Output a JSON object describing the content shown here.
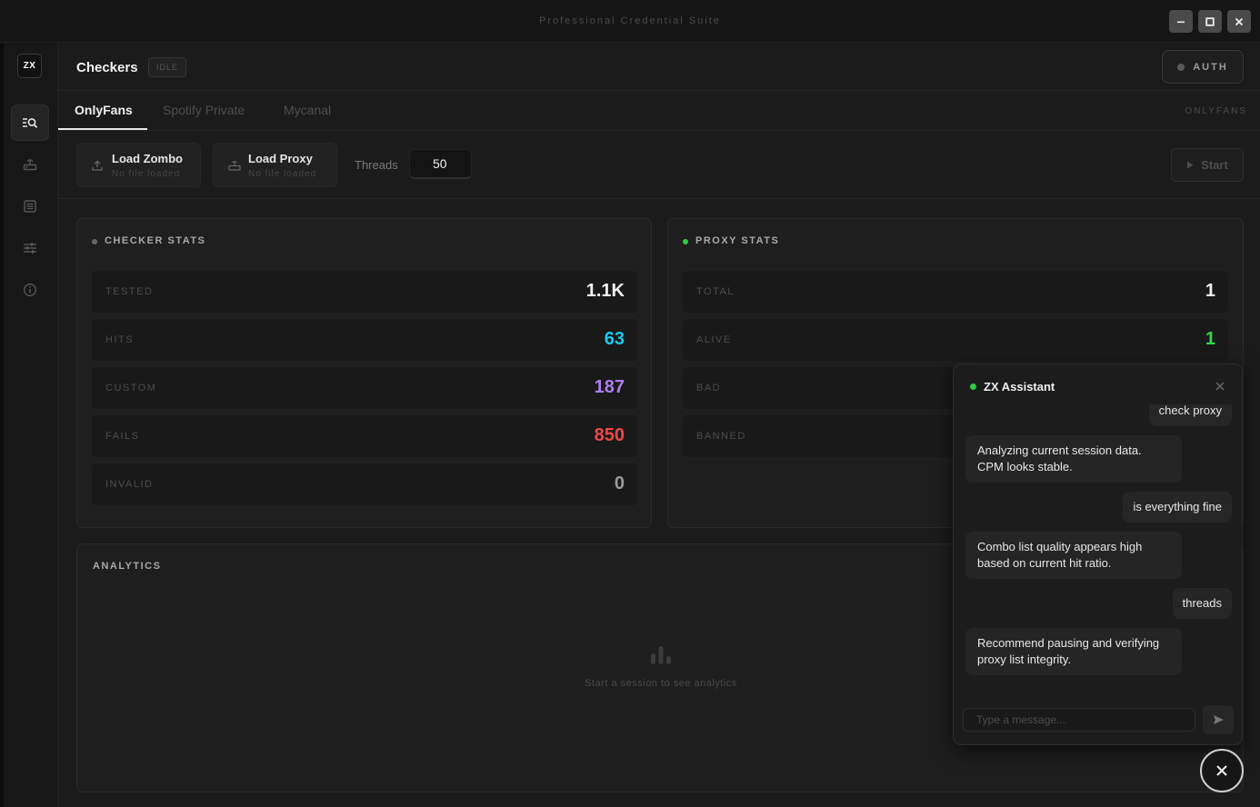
{
  "window": {
    "title": "Professional Credential Suite"
  },
  "sidebar": {
    "logo": "ZX"
  },
  "header": {
    "title": "Checkers",
    "status": "IDLE",
    "auth_label": "AUTH"
  },
  "tabs": {
    "items": [
      {
        "label": "OnlyFans"
      },
      {
        "label": "Spotify Private"
      },
      {
        "label": "Mycanal"
      }
    ],
    "right_label": "ONLYFANS"
  },
  "toolbar": {
    "load_combo": {
      "title": "Load Zombo",
      "sub": "No file loaded"
    },
    "load_proxy": {
      "title": "Load Proxy",
      "sub": "No file loaded"
    },
    "threads_label": "Threads",
    "threads_value": "50",
    "start_label": "Start"
  },
  "checker_stats": {
    "title": "CHECKER STATS",
    "rows": [
      {
        "label": "TESTED",
        "value": "1.1K",
        "color": "#f2f2f2"
      },
      {
        "label": "HITS",
        "value": "63",
        "color": "#1ec8f0"
      },
      {
        "label": "CUSTOM",
        "value": "187",
        "color": "#b07cf0"
      },
      {
        "label": "FAILS",
        "value": "850",
        "color": "#f04848"
      },
      {
        "label": "INVALID",
        "value": "0",
        "color": "#9a9a9a"
      }
    ]
  },
  "proxy_stats": {
    "title": "PROXY STATS",
    "rows": [
      {
        "label": "TOTAL",
        "value": "1",
        "color": "#f2f2f2"
      },
      {
        "label": "ALIVE",
        "value": "1",
        "color": "#32d74b"
      },
      {
        "label": "BAD",
        "value": "",
        "color": "#f04848"
      },
      {
        "label": "BANNED",
        "value": "",
        "color": "#9a9a9a"
      }
    ]
  },
  "analytics": {
    "title": "ANALYTICS",
    "empty_text": "Start a session to see analytics"
  },
  "assistant": {
    "title": "ZX Assistant",
    "messages": [
      {
        "role": "user",
        "text": "check proxy"
      },
      {
        "role": "bot",
        "text": "Analyzing current session data. CPM looks stable."
      },
      {
        "role": "user",
        "text": "is everything fine"
      },
      {
        "role": "bot",
        "text": "Combo list quality appears high based on current hit ratio."
      },
      {
        "role": "user",
        "text": "threads"
      },
      {
        "role": "bot",
        "text": "Recommend pausing and verifying proxy list integrity."
      }
    ],
    "input_placeholder": "Type a message..."
  }
}
